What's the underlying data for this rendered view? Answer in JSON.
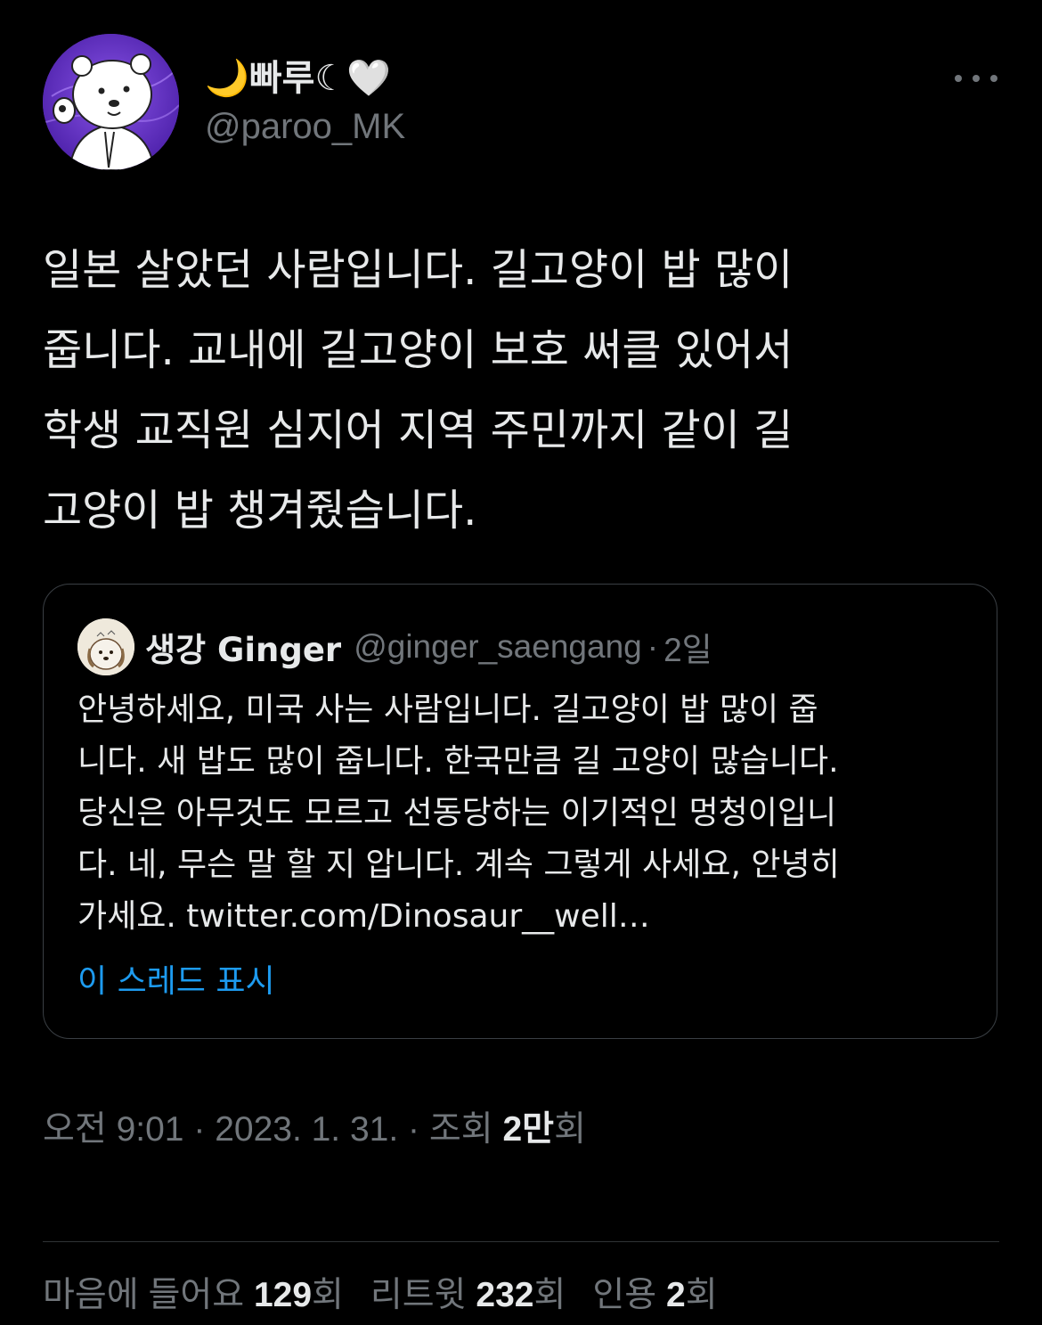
{
  "tweet": {
    "author": {
      "display_name": "🌙빠루☾🤍",
      "handle": "@paroo_MK",
      "avatar_icon": "polar-bear-avatar-icon"
    },
    "more_icon": "more-horizontal-icon",
    "text_lines": [
      "일본 살았던 사람입니다. 길고양이 밥 많이",
      "줍니다. 교내에 길고양이 보호 써클 있어서",
      "학생 교직원 심지어 지역 주민까지 같이 길",
      "고양이 밥 챙겨줬습니다."
    ]
  },
  "quote": {
    "display_name": "생강 Ginger",
    "handle": "@ginger_saengang",
    "separator": "·",
    "time": "2일",
    "avatar_icon": "dog-drawing-avatar-icon",
    "text_lines": [
      "안녕하세요, 미국 사는 사람입니다. 길고양이 밥 많이 줍",
      "니다. 새 밥도 많이 줍니다. 한국만큼 길 고양이 많습니다.",
      "당신은 아무것도 모르고 선동당하는 이기적인 멍청이입니",
      "다. 네, 무슨 말 할 지 압니다. 계속 그렇게 사세요, 안녕히",
      "가세요. twitter.com/Dinosaur__well…"
    ],
    "show_thread": "이 스레드 표시"
  },
  "meta": {
    "time": "오전 9:01",
    "sep1": " · ",
    "date": "2023. 1. 31.",
    "sep2": " · ",
    "views_label": "조회 ",
    "views_value": "2만",
    "views_suffix": "회"
  },
  "stats": {
    "likes_label": "마음에 들어요 ",
    "likes_value": "129",
    "likes_suffix": "회",
    "retweets_label": "리트윗 ",
    "retweets_value": "232",
    "retweets_suffix": "회",
    "quotes_label": "인용 ",
    "quotes_value": "2",
    "quotes_suffix": "회"
  },
  "colors": {
    "background": "#000000",
    "text": "#e7e9ea",
    "secondary": "#71767b",
    "link": "#1d9bf0",
    "border": "#3a3f44",
    "avatar_purple": "#6a35c9"
  }
}
